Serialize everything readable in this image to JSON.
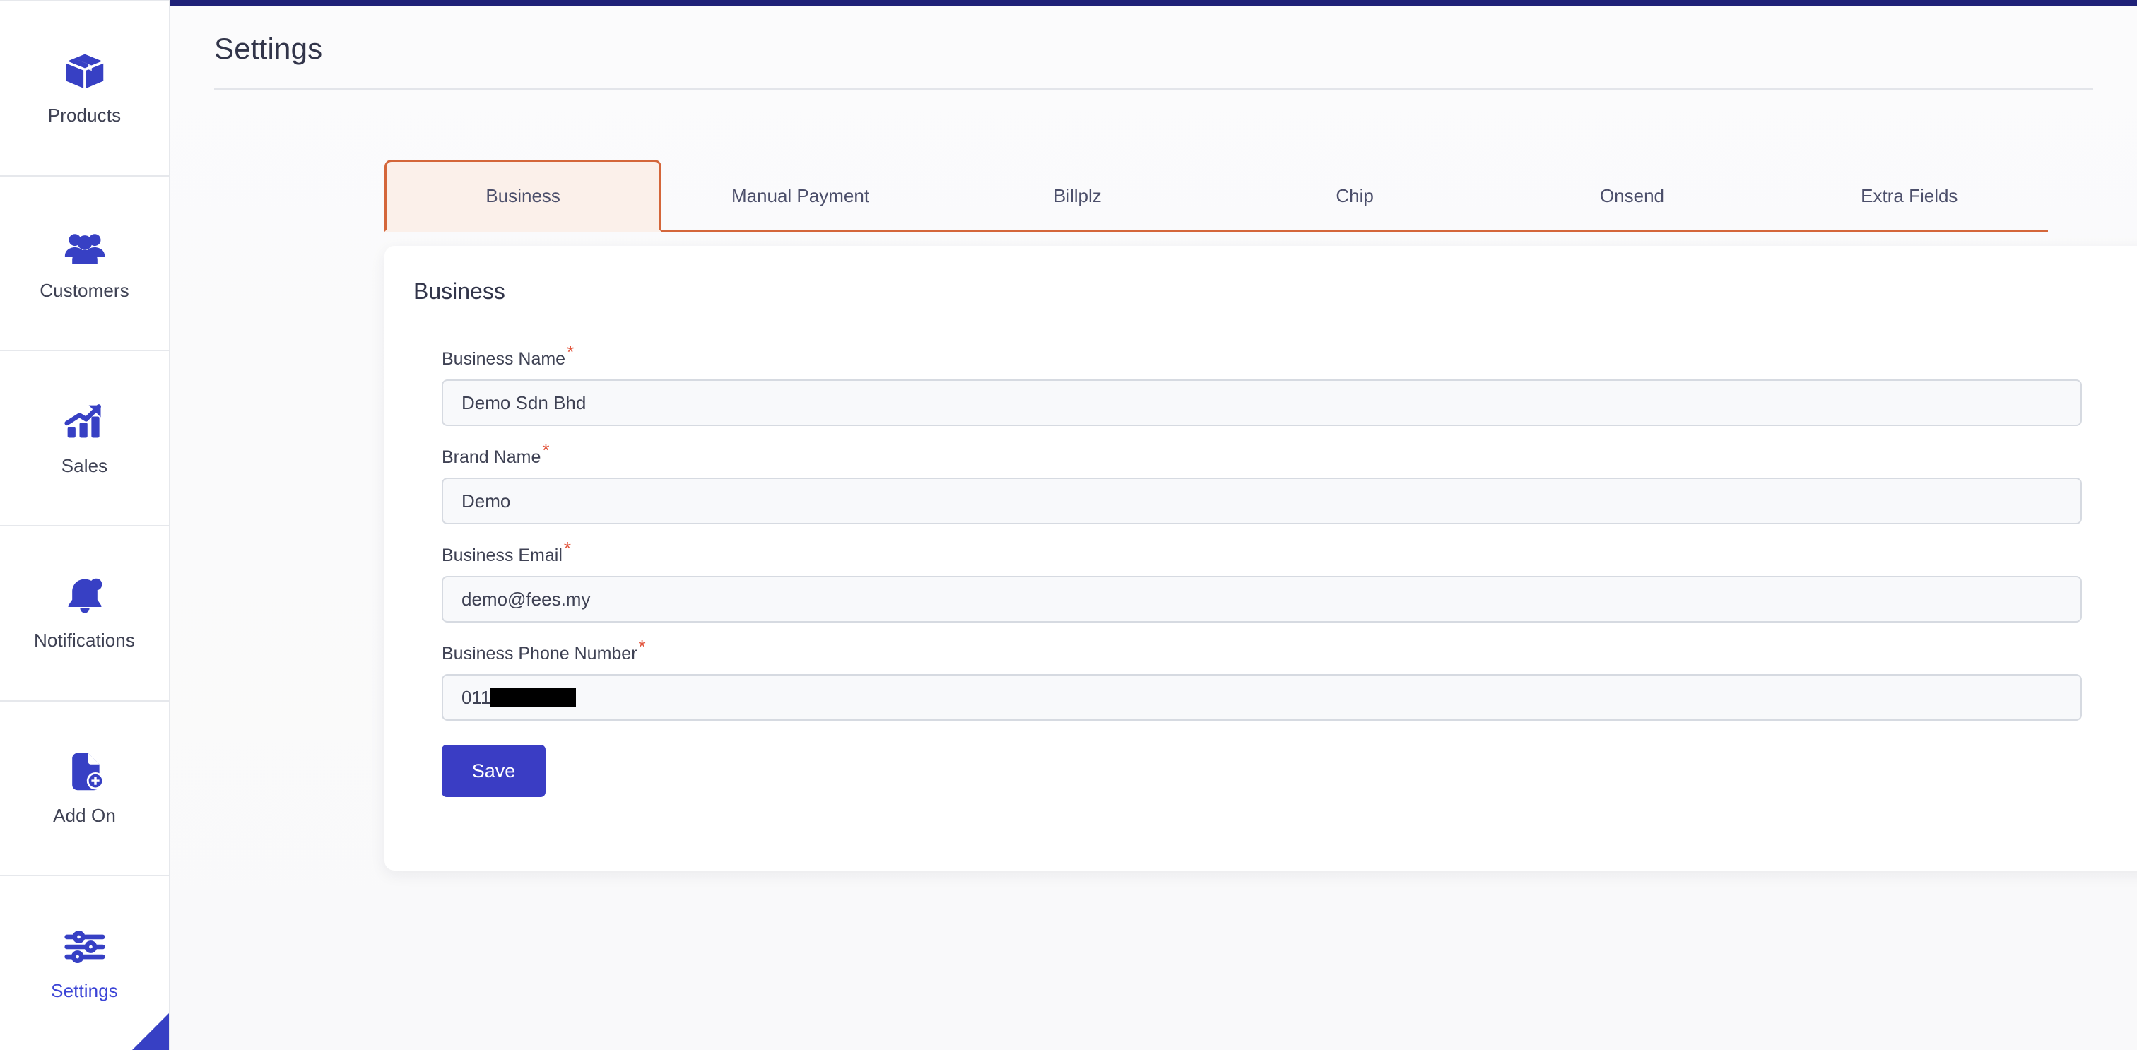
{
  "topbar": {
    "color": "#1f2178"
  },
  "sidebar": {
    "items": [
      {
        "label": "Products",
        "icon": "box-icon",
        "active": false
      },
      {
        "label": "Customers",
        "icon": "people-group-icon",
        "active": false
      },
      {
        "label": "Sales",
        "icon": "chart-growth-icon",
        "active": false
      },
      {
        "label": "Notifications",
        "icon": "bell-icon",
        "active": false
      },
      {
        "label": "Add On",
        "icon": "document-plus-icon",
        "active": false
      },
      {
        "label": "Settings",
        "icon": "sliders-icon",
        "active": true
      }
    ],
    "active_color": "#3b44d6",
    "icon_color": "#3740c4"
  },
  "header": {
    "title": "Settings"
  },
  "tabs": {
    "active_index": 0,
    "accent_color": "#d4663a",
    "active_background": "#fbf0ea",
    "items": [
      {
        "label": "Business"
      },
      {
        "label": "Manual Payment"
      },
      {
        "label": "Billplz"
      },
      {
        "label": "Chip"
      },
      {
        "label": "Onsend"
      },
      {
        "label": "Extra Fields"
      }
    ]
  },
  "card": {
    "title": "Business",
    "fields": [
      {
        "label": "Business Name",
        "required": true,
        "value": "Demo Sdn Bhd",
        "redacted": false
      },
      {
        "label": "Brand Name",
        "required": true,
        "value": "Demo",
        "redacted": false
      },
      {
        "label": "Business Email",
        "required": true,
        "value": "demo@fees.my",
        "redacted": false
      },
      {
        "label": "Business Phone Number",
        "required": true,
        "value": "011",
        "redacted": true
      }
    ],
    "save_label": "Save",
    "save_color": "#3a3dc4"
  }
}
